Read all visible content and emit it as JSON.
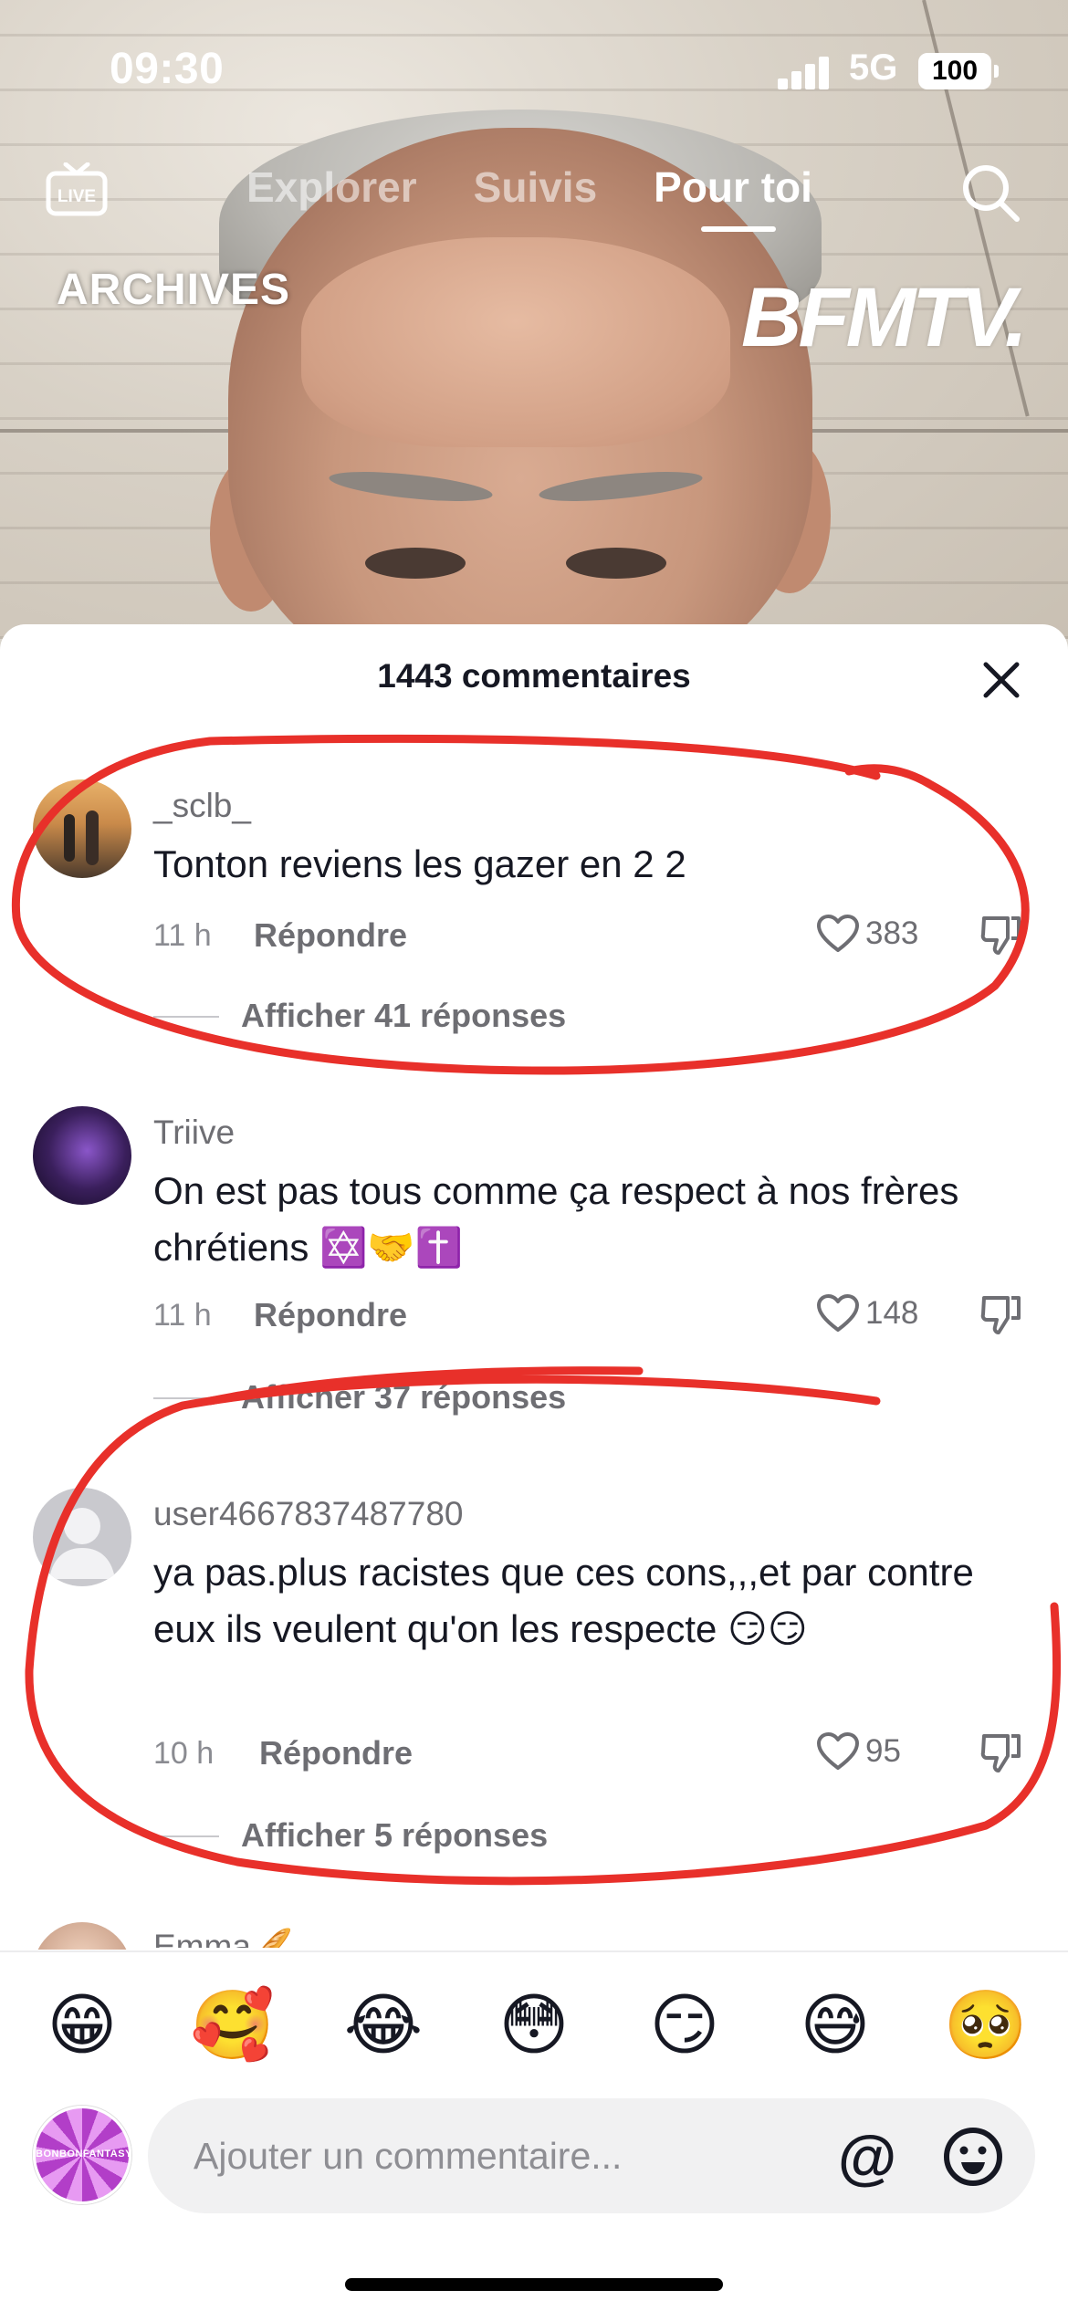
{
  "status_bar": {
    "time": "09:30",
    "network": "5G",
    "battery": "100"
  },
  "top_nav": {
    "tabs": [
      {
        "label": "Explorer",
        "active": false
      },
      {
        "label": "Suivis",
        "active": false
      },
      {
        "label": "Pour toi",
        "active": true
      }
    ],
    "live_icon_label": "LIVE"
  },
  "video": {
    "overlay_text": "ARCHIVES",
    "channel_logo": "BFMTV."
  },
  "comments_sheet": {
    "title": "1443 commentaires",
    "comments": [
      {
        "username": "_sclb_",
        "text": "Tonton reviens les gazer en 2 2",
        "time": "11 h",
        "reply_label": "Répondre",
        "likes": "383",
        "view_replies": "Afficher 41 réponses"
      },
      {
        "username": "Triive",
        "text": "On est pas tous comme ça respect à nos frères chrétiens ✡️🤝✝️",
        "time": "11 h",
        "reply_label": "Répondre",
        "likes": "148",
        "view_replies": "Afficher 37 réponses"
      },
      {
        "username": "user4667837487780",
        "text": "ya pas.plus racistes que ces cons,,,et par contre eux ils veulent qu'on les respecte 😏😏",
        "time": "10 h",
        "reply_label": "Répondre",
        "likes": "95",
        "view_replies": "Afficher 5 réponses"
      }
    ],
    "partial_comment_username": "Emma🥖"
  },
  "composer": {
    "quick_emojis": [
      "😁",
      "🥰",
      "😂",
      "😳",
      "😏",
      "😅",
      "🥺"
    ],
    "placeholder": "Ajouter un commentaire...",
    "mention_symbol": "@",
    "my_avatar_label": "BONBONFANTASY"
  },
  "colors": {
    "annotation_red": "#e8302a",
    "text_primary": "#161823",
    "text_secondary": "#6e6e73"
  }
}
